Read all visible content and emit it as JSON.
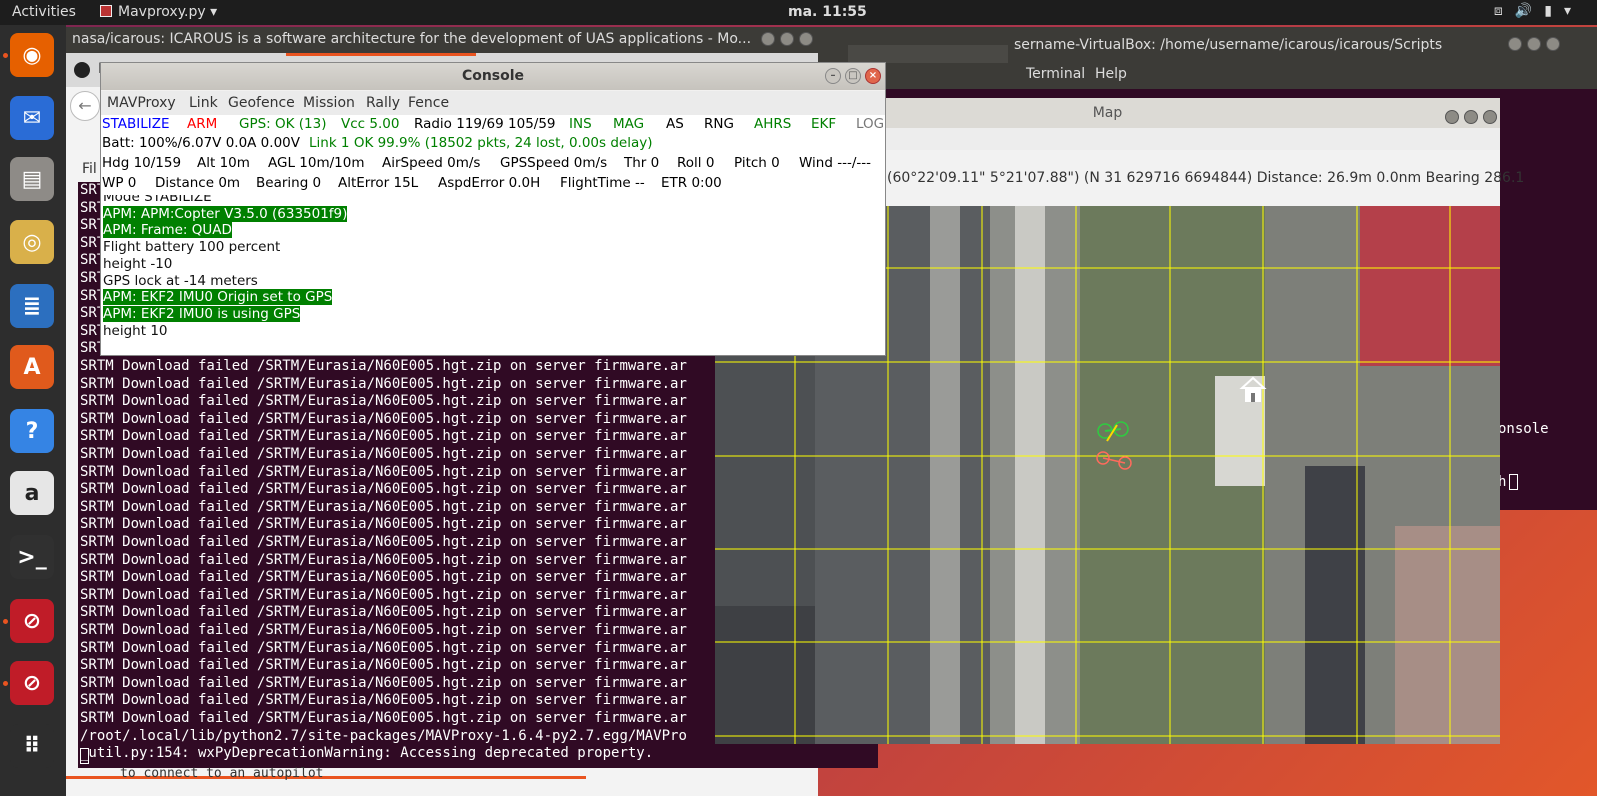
{
  "topbar": {
    "activities": "Activities",
    "app_name": "Mavproxy.py",
    "app_menu_arrow": "▾",
    "clock": "ma. 11:55",
    "tray_icons": [
      "network-icon",
      "volume-icon",
      "battery-icon",
      "chevron-down-icon"
    ]
  },
  "dock": {
    "items": [
      {
        "name": "firefox",
        "icon": "firefox-icon",
        "color": "#e66000"
      },
      {
        "name": "thunderbird",
        "icon": "thunderbird-icon",
        "color": "#2a6cd6"
      },
      {
        "name": "files",
        "icon": "files-icon",
        "color": "#8e8b87"
      },
      {
        "name": "rhythmbox",
        "icon": "rhythmbox-icon",
        "color": "#d9b04a"
      },
      {
        "name": "writer",
        "icon": "writer-icon",
        "color": "#2c6fbf"
      },
      {
        "name": "software",
        "icon": "software-icon",
        "color": "#e05a1c"
      },
      {
        "name": "help",
        "icon": "help-icon",
        "color": "#3584e4"
      },
      {
        "name": "amazon",
        "icon": "amazon-icon",
        "color": "#e6e6e6"
      },
      {
        "name": "terminal",
        "icon": "terminal-icon",
        "color": "#303030"
      },
      {
        "name": "app-error-1",
        "icon": "no-entry-icon",
        "color": "#c01c28"
      },
      {
        "name": "app-error-2",
        "icon": "no-entry-icon",
        "color": "#c01c28"
      },
      {
        "name": "show-apps",
        "icon": "grid-icon",
        "color": "#2d2d2d"
      }
    ]
  },
  "browser": {
    "title": "nasa/icarous: ICAROUS is a software architecture for the development of UAS applications - Mo...",
    "tab_letter": "H",
    "back_glyph": "←",
    "file_menu_fragment": "Fil"
  },
  "terminal": {
    "left_fragment_lines": [
      "SRT",
      "SRT",
      "SRT",
      "SRT",
      "SRT",
      "SRT",
      "SRT",
      "SRT",
      "SRT",
      "SRT"
    ],
    "srtm_line": "SRTM Download failed /SRTM/Eurasia/N60E005.hgt.zip on server firmware.ar",
    "srtm_count": 21,
    "path_line": "/root/.local/lib/python2.7/site-packages/MAVProxy-1.6.4-py2.7.egg/MAVPro",
    "warning_line": "_util.py:154: wxPyDeprecationWarning: Accessing deprecated property.",
    "bottom_text": "to connect to an autopilot"
  },
  "term2": {
    "title": "sername-VirtualBox: /home/username/icarous/icarous/Scripts",
    "menu_terminal": "Terminal",
    "menu_help": "Help",
    "console_text": "onsole",
    "h_text": "h"
  },
  "map": {
    "title": "Map",
    "status": "(60°22'09.11\" 5°21'07.88\") (N 31 629716 6694844)  Distance: 26.9m 0.0nm Bearing 286.1"
  },
  "console": {
    "title": "Console",
    "menu": [
      "MAVProxy",
      "Link",
      "Geofence",
      "Mission",
      "Rally",
      "Fence"
    ],
    "row1": [
      {
        "text": "STABILIZE",
        "color": "#0000ff"
      },
      {
        "text": "ARM",
        "color": "#ff0000"
      },
      {
        "text": "GPS: OK (13)",
        "color": "#008000"
      },
      {
        "text": "Vcc 5.00",
        "color": "#008000"
      },
      {
        "text": "Radio 119/69 105/59",
        "color": "#000000"
      },
      {
        "text": "INS",
        "color": "#008000"
      },
      {
        "text": "MAG",
        "color": "#008000"
      },
      {
        "text": "AS",
        "color": "#000000"
      },
      {
        "text": "RNG",
        "color": "#000000"
      },
      {
        "text": "AHRS",
        "color": "#008000"
      },
      {
        "text": "EKF",
        "color": "#008000"
      },
      {
        "text": "LOG",
        "color": "#777777"
      }
    ],
    "row2": [
      {
        "text": "Batt: 100%/6.07V 0.0A 0.00V",
        "color": "#000000"
      },
      {
        "text": "Link 1 OK 99.9% (18502 pkts, 24 lost, 0.00s delay)",
        "color": "#008000"
      }
    ],
    "row3": [
      "Hdg 10/159",
      "Alt 10m",
      "AGL 10m/10m",
      "AirSpeed 0m/s",
      "GPSSpeed 0m/s",
      "Thr 0",
      "Roll 0",
      "Pitch 0",
      "Wind ---/---"
    ],
    "row4": [
      "WP 0",
      "Distance 0m",
      "Bearing 0",
      "AltError 15L",
      "AspdError 0.0H",
      "FlightTime --",
      "ETR 0:00"
    ],
    "log": [
      {
        "text": "Mode STABILIZE",
        "hl": false
      },
      {
        "text": "APM: APM:Copter V3.5.0 (633501f9)",
        "hl": true
      },
      {
        "text": "APM: Frame: QUAD",
        "hl": true
      },
      {
        "text": "Flight battery 100 percent",
        "hl": false
      },
      {
        "text": "height -10",
        "hl": false
      },
      {
        "text": "GPS lock at -14 meters",
        "hl": false
      },
      {
        "text": "APM: EKF2 IMU0 Origin set to GPS",
        "hl": true
      },
      {
        "text": "APM: EKF2 IMU0 is using GPS",
        "hl": true
      },
      {
        "text": "height 10",
        "hl": false
      }
    ]
  }
}
